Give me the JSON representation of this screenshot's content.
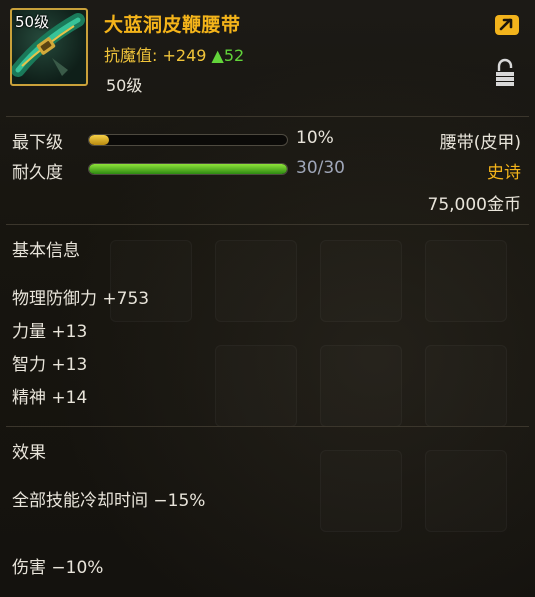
{
  "item": {
    "level_badge": "50级",
    "name": "大蓝洞皮鞭腰带",
    "magic_label": "抗魔值:",
    "magic_value": "+249",
    "magic_delta": "▲52",
    "level_text": "50级"
  },
  "stats": {
    "grade_label": "最下级",
    "grade_pct": "10%",
    "grade_fill": 0.1,
    "durability_label": "耐久度",
    "durability_value": "30/30",
    "durability_fill": 1.0,
    "item_type": "腰带(皮甲)",
    "rarity": "史诗",
    "price": "75,000金币"
  },
  "basic_info": {
    "title": "基本信息",
    "lines": [
      "物理防御力 +753",
      "力量 +13",
      "智力 +13",
      "精神 +14"
    ]
  },
  "effects": {
    "title": "效果",
    "lines": [
      "全部技能冷却时间 −15%",
      "伤害 −10%"
    ]
  },
  "colors": {
    "name": "#f4b41a",
    "rarity": "#f4b41a",
    "magic_delta": "#62d43a",
    "frame": "#c9a13a"
  },
  "icons": [
    "belt-item-icon",
    "share-icon",
    "lock-icon"
  ]
}
